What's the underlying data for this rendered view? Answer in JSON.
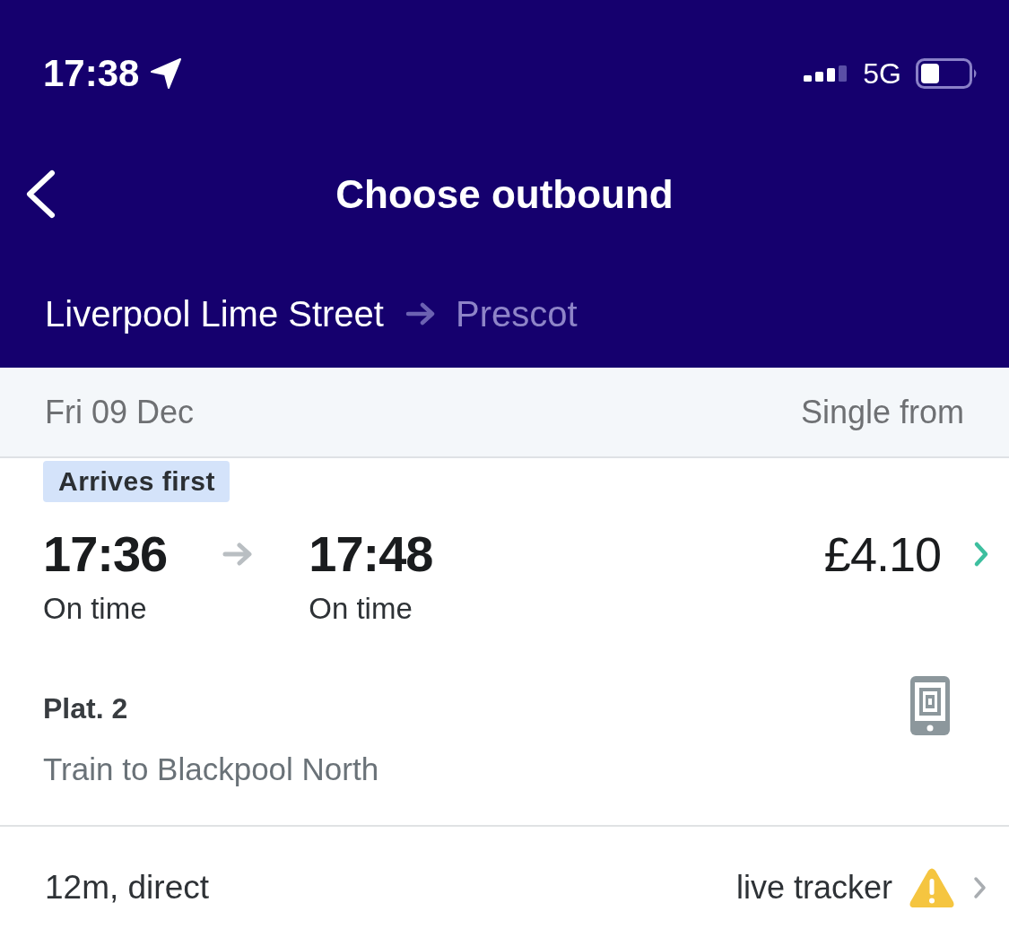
{
  "status_bar": {
    "time": "17:38",
    "network": "5G"
  },
  "header": {
    "title": "Choose outbound",
    "origin": "Liverpool Lime Street",
    "destination": "Prescot"
  },
  "date_bar": {
    "date": "Fri 09 Dec",
    "price_label": "Single from"
  },
  "journeys": [
    {
      "badge": "Arrives first",
      "depart": {
        "time": "17:36",
        "status": "On time"
      },
      "arrive": {
        "time": "17:48",
        "status": "On time"
      },
      "price": "£4.10",
      "platform": "Plat. 2",
      "service": "Train to Blackpool North",
      "duration": "12m, direct",
      "tracker": {
        "label": "live tracker",
        "warning": true
      }
    }
  ]
}
